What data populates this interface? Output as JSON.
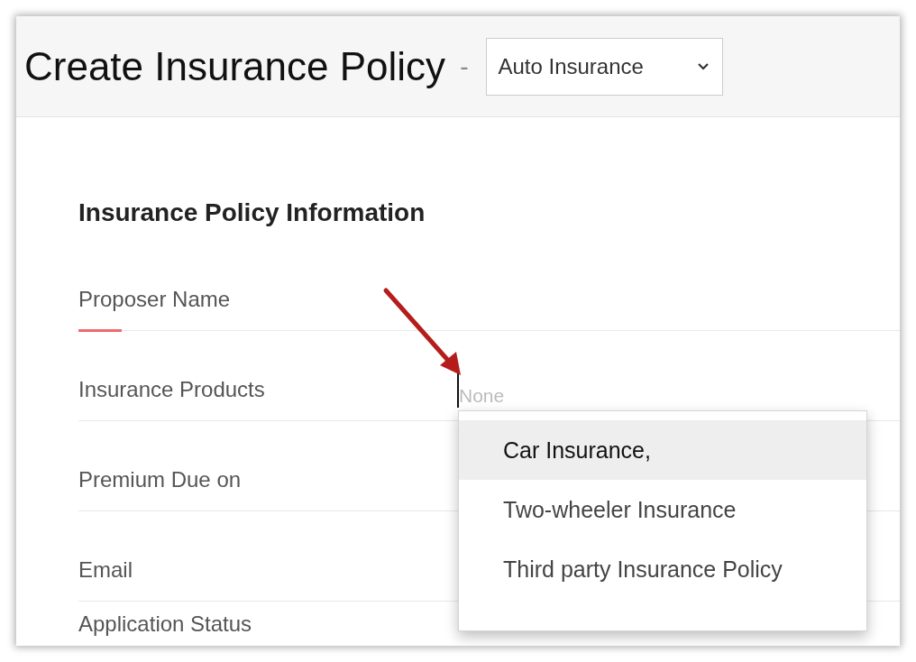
{
  "header": {
    "title": "Create Insurance Policy",
    "separator": "-",
    "policy_type": {
      "value": "Auto Insurance"
    }
  },
  "section": {
    "title": "Insurance Policy Information",
    "fields": [
      {
        "label": "Proposer Name",
        "kind": "text",
        "focused": true
      },
      {
        "label": "Insurance Products",
        "kind": "picklist",
        "focused": false,
        "placeholder": "None"
      },
      {
        "label": "Premium Due on",
        "kind": "text",
        "focused": false
      },
      {
        "label": "Email",
        "kind": "text",
        "focused": false
      },
      {
        "label": "Application Status",
        "kind": "text",
        "focused": false
      }
    ]
  },
  "dropdown": {
    "options": [
      {
        "label": "Car Insurance,",
        "selected": true
      },
      {
        "label": "Two-wheeler Insurance",
        "selected": false
      },
      {
        "label": "Third party Insurance Policy",
        "selected": false
      }
    ]
  }
}
